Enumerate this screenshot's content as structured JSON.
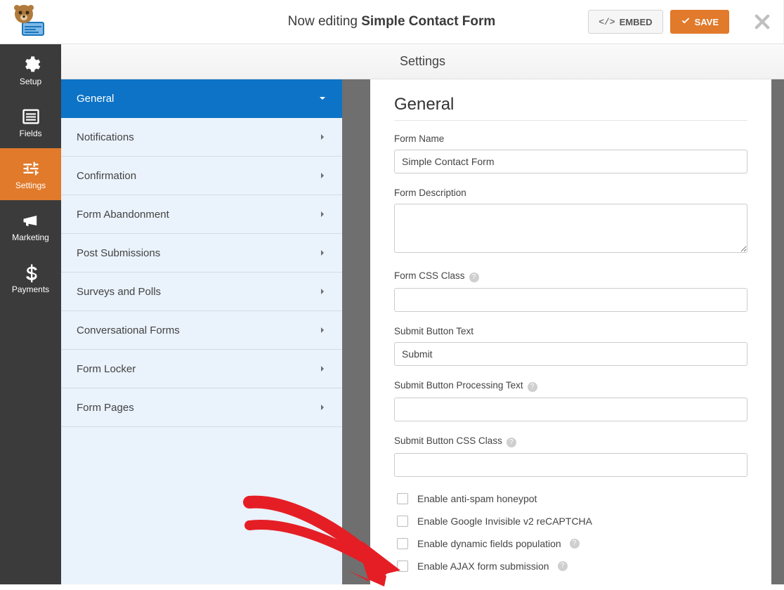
{
  "topbar": {
    "editing_prefix": "Now editing ",
    "editing_name": "Simple Contact Form",
    "embed_label": "EMBED",
    "save_label": "SAVE"
  },
  "nav": {
    "setup": "Setup",
    "fields": "Fields",
    "settings": "Settings",
    "marketing": "Marketing",
    "payments": "Payments"
  },
  "content_header": "Settings",
  "subnav": {
    "general": "General",
    "notifications": "Notifications",
    "confirmation": "Confirmation",
    "form_abandonment": "Form Abandonment",
    "post_submissions": "Post Submissions",
    "surveys_polls": "Surveys and Polls",
    "conversational_forms": "Conversational Forms",
    "form_locker": "Form Locker",
    "form_pages": "Form Pages"
  },
  "panel": {
    "heading": "General",
    "form_name_label": "Form Name",
    "form_name_value": "Simple Contact Form",
    "form_description_label": "Form Description",
    "form_description_value": "",
    "form_css_class_label": "Form CSS Class",
    "form_css_class_value": "",
    "submit_button_text_label": "Submit Button Text",
    "submit_button_text_value": "Submit",
    "submit_processing_label": "Submit Button Processing Text",
    "submit_processing_value": "",
    "submit_css_class_label": "Submit Button CSS Class",
    "submit_css_class_value": "",
    "cb_antispam": "Enable anti-spam honeypot",
    "cb_recaptcha": "Enable Google Invisible v2 reCAPTCHA",
    "cb_dynamic": "Enable dynamic fields population",
    "cb_ajax": "Enable AJAX form submission"
  },
  "colors": {
    "accent": "#e17a2b",
    "primary_nav": "#0d73c6"
  }
}
